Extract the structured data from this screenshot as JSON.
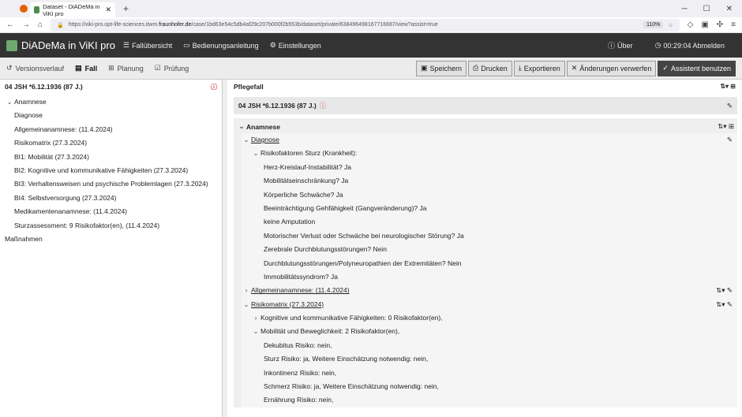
{
  "browser": {
    "tab_title": "Dataset - DiADeMa in ViKI pro",
    "url_prefix": "https://viki-pro.opt-life-sciences.itwm.",
    "url_host": "fraunhofer.de",
    "url_path": "/case/1bd63e54c5db4af29c207b000f2b553b/dataset/private/638496498167716687/view?assist=true",
    "zoom": "110%"
  },
  "app": {
    "brand": "DiADeMa in ViKI pro",
    "menu": [
      "Fallübersicht",
      "Bedienungsanleitung",
      "Einstellungen"
    ],
    "about": "Über",
    "timer": "00:29:04 Abmelden"
  },
  "toolbar": {
    "tabs": [
      "Versionsverlauf",
      "Fall",
      "Planung",
      "Prüfung"
    ],
    "buttons": [
      "Speichern",
      "Drucken",
      "Exportieren",
      "Änderungen verwerfen",
      "Assistent benutzen"
    ]
  },
  "left": {
    "title": "04 JSH *6.12.1936 (87 J.)",
    "anamnese": "Anamnese",
    "items": [
      "Diagnose",
      "Allgemeinanamnese: (11.4.2024)",
      "Risikomatrix (27.3.2024)",
      "BI1: Mobilität (27.3.2024)",
      "BI2: Kognitive und kommunikative Fähigkeiten (27.3.2024)",
      "BI3: Verhaltensweisen und psychische Problemlagen (27.3.2024)",
      "BI4: Selbstversorgung (27.3.2024)",
      "Medikamentenanamnese: (11.4.2024)",
      "Sturzassessment: 9 Risikofaktor(en), (11.4.2024)"
    ],
    "massnahmen": "Maßnahmen"
  },
  "right": {
    "header": "Pflegefall",
    "case": "04 JSH *6.12.1936 (87 J.)",
    "anamnese": "Anamnese",
    "diagnose": "Diagnose",
    "risk_group": "Risikofaktoren Sturz (Krankheit):",
    "risk_items": [
      "Herz-Kreislauf-Instabilität? Ja",
      "Mobilitätseinschränkung? Ja",
      "Körperliche Schwäche? Ja",
      "Beeinträchtigung Gehfähigkeit (Gangveränderung)? Ja",
      "keine Amputation",
      "Motorischer Verlust oder Schwäche bei neurologischer Störung? Ja",
      "Zerebrale Durchblutungsstörungen? Nein",
      "Durchblutungsstörungen/Polyneuropathien der Extremitäten? Nein",
      "Immobilitätssyndrom? Ja"
    ],
    "allgemein": "Allgemeinanamnese: (11.4.2024)",
    "risikomatrix": "Risikomatrix (27.3.2024)",
    "kognitiv": "Kognitive und kommunikative Fähigkeiten: 0 Risikofaktor(en),",
    "mobil": "Mobilität und Beweglichkeit: 2 Risikofaktor(en),",
    "mobil_items": [
      "Dekubitus Risiko: nein,",
      "Sturz Risiko: ja, Weitere Einschätzung notwendig: nein,",
      "Inkontinenz Risiko: nein,",
      "Schmerz Risiko: ja, Weitere Einschätzung notwendig: nein,",
      "Ernährung Risiko: nein,"
    ]
  }
}
